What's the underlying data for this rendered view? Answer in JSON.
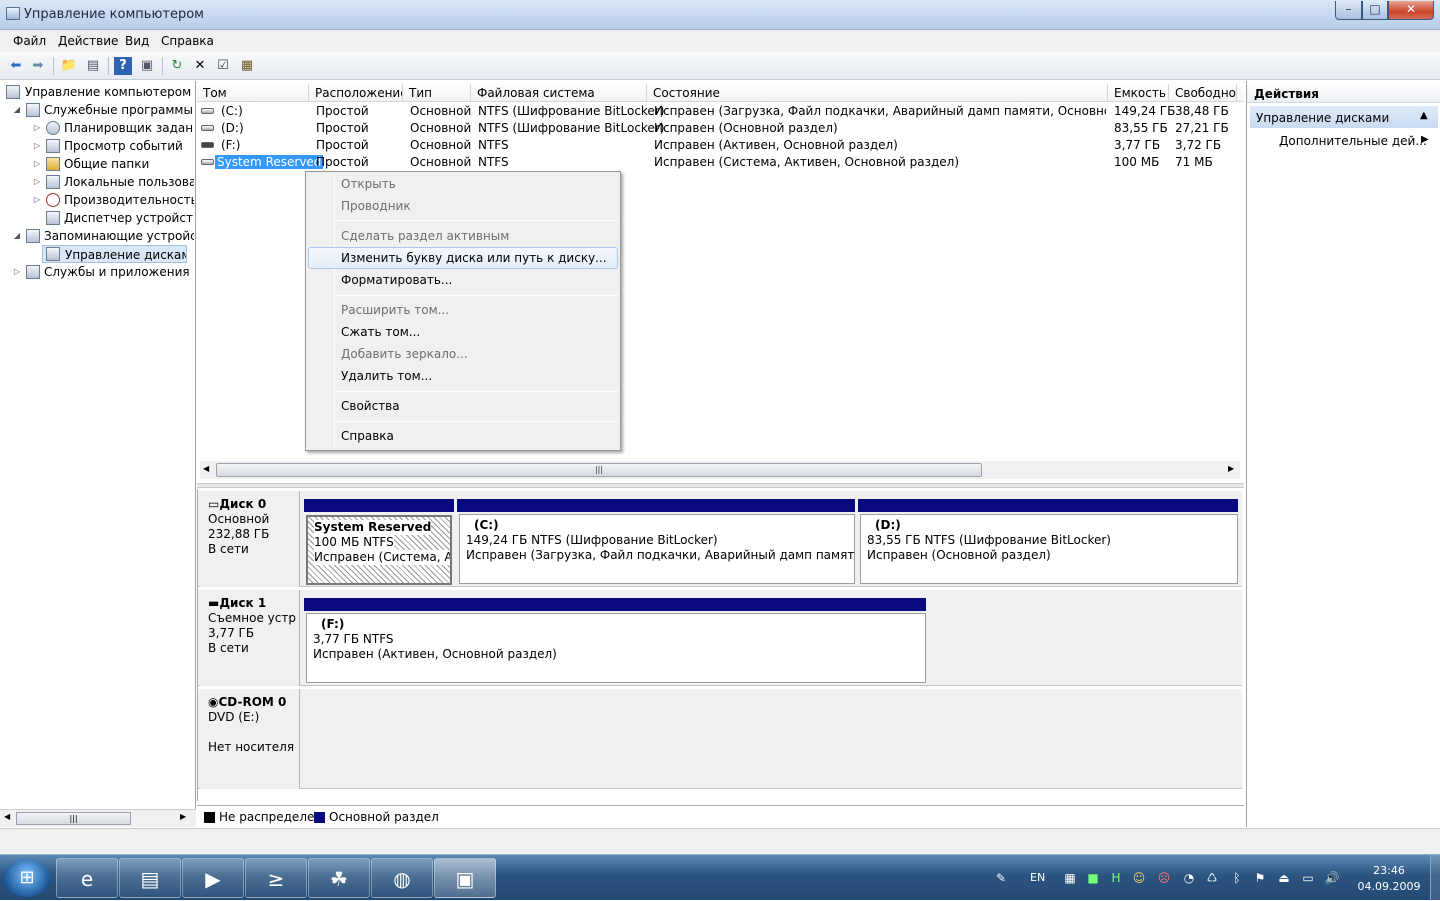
{
  "window": {
    "title": "Управление компьютером",
    "btn_min": "–",
    "btn_max": "□",
    "btn_close": "✕"
  },
  "menubar": [
    "Файл",
    "Действие",
    "Вид",
    "Справка"
  ],
  "tree": [
    {
      "label": "Управление компьютером (л",
      "indent": 0,
      "expander": ""
    },
    {
      "label": "Служебные программы",
      "indent": 1,
      "expander": "◢"
    },
    {
      "label": "Планировщик заданий",
      "indent": 2,
      "expander": "▷"
    },
    {
      "label": "Просмотр событий",
      "indent": 2,
      "expander": "▷"
    },
    {
      "label": "Общие папки",
      "indent": 2,
      "expander": "▷"
    },
    {
      "label": "Локальные пользовате",
      "indent": 2,
      "expander": "▷"
    },
    {
      "label": "Производительность",
      "indent": 2,
      "expander": "▷"
    },
    {
      "label": "Диспетчер устройств",
      "indent": 2,
      "expander": ""
    },
    {
      "label": "Запоминающие устройст",
      "indent": 1,
      "expander": "◢"
    },
    {
      "label": "Управление дисками",
      "indent": 2,
      "expander": ""
    },
    {
      "label": "Службы и приложения",
      "indent": 1,
      "expander": "▷"
    }
  ],
  "volumes": {
    "headers": [
      "Том",
      "Расположение",
      "Тип",
      "Файловая система",
      "Состояние",
      "Емкость",
      "Свободно"
    ],
    "rows": [
      [
        "(C:)",
        "Простой",
        "Основной",
        "NTFS (Шифрование BitLocker)",
        "Исправен (Загрузка, Файл подкачки, Аварийный дамп памяти, Основной раздел)",
        "149,24 ГБ",
        "38,48 ГБ"
      ],
      [
        "(D:)",
        "Простой",
        "Основной",
        "NTFS (Шифрование BitLocker)",
        "Исправен (Основной раздел)",
        "83,55 ГБ",
        "27,21 ГБ"
      ],
      [
        "(F:)",
        "Простой",
        "Основной",
        "NTFS",
        "Исправен (Активен, Основной раздел)",
        "3,77 ГБ",
        "3,72 ГБ"
      ],
      [
        "System Reserved",
        "Простой",
        "Основной",
        "NTFS",
        "Исправен (Система, Активен, Основной раздел)",
        "100 МБ",
        "71 МБ"
      ]
    ]
  },
  "context_menu": {
    "items": [
      {
        "label": "Открыть",
        "enabled": false
      },
      {
        "label": "Проводник",
        "enabled": false
      },
      {
        "label": "Сделать раздел активным",
        "enabled": false
      },
      {
        "label": "Изменить букву диска или путь к диску...",
        "enabled": true,
        "highlighted": true
      },
      {
        "label": "Форматировать...",
        "enabled": true
      },
      {
        "label": "Расширить том...",
        "enabled": false
      },
      {
        "label": "Сжать том...",
        "enabled": true
      },
      {
        "label": "Добавить зеркало...",
        "enabled": false
      },
      {
        "label": "Удалить том...",
        "enabled": true
      },
      {
        "label": "Свойства",
        "enabled": true
      },
      {
        "label": "Справка",
        "enabled": true
      }
    ]
  },
  "disks": [
    {
      "name": "Диск 0",
      "type": "Основной",
      "size": "232,88 ГБ",
      "status": "В сети",
      "partitions": [
        {
          "title": "System Reserved",
          "line1": "100 МБ NTFS",
          "line2": "Исправен (Система, Активен, Основной раздел)"
        },
        {
          "title": "(C:)",
          "line1": "149,24 ГБ NTFS (Шифрование BitLocker)",
          "line2": "Исправен (Загрузка, Файл подкачки, Аварийный дамп памяти, Основной раздел)"
        },
        {
          "title": "(D:)",
          "line1": "83,55 ГБ NTFS (Шифрование BitLocker)",
          "line2": "Исправен (Основной раздел)"
        }
      ]
    },
    {
      "name": "Диск 1",
      "type": "Съемное устройство",
      "size": "3,77 ГБ",
      "status": "В сети",
      "partitions": [
        {
          "title": "(F:)",
          "line1": "3,77 ГБ NTFS",
          "line2": "Исправен (Активен, Основной раздел)"
        }
      ]
    },
    {
      "name": "CD-ROM 0",
      "type": "DVD (E:)",
      "size": "",
      "status": "Нет носителя",
      "partitions": []
    }
  ],
  "legend": [
    {
      "label": "Не распределен",
      "color": "#000000"
    },
    {
      "label": "Основной раздел",
      "color": "#0a0a80"
    }
  ],
  "actions": {
    "title": "Действия",
    "section": "Управление дисками",
    "item": "Дополнительные дей..."
  },
  "tray": {
    "lang": "EN",
    "time": "23:46",
    "date": "04.09.2009"
  },
  "colors": {
    "partition_bar": "#0a0a80",
    "selection": "#3399ff"
  }
}
